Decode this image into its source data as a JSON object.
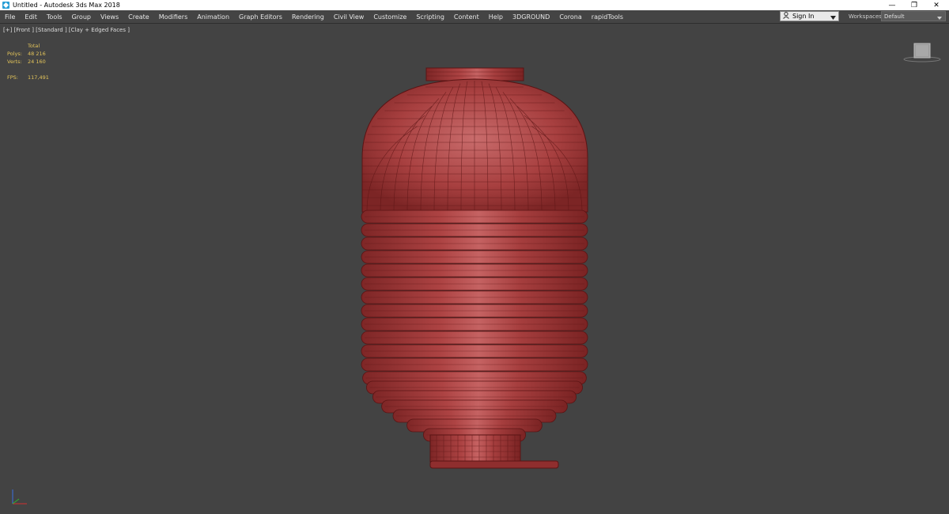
{
  "window": {
    "title": "Untitled - Autodesk 3ds Max 2018",
    "minimize_glyph": "—",
    "restore_glyph": "❐",
    "close_glyph": "✕"
  },
  "menu": [
    "File",
    "Edit",
    "Tools",
    "Group",
    "Views",
    "Create",
    "Modifiers",
    "Animation",
    "Graph Editors",
    "Rendering",
    "Civil View",
    "Customize",
    "Scripting",
    "Content",
    "Help",
    "3DGROUND",
    "Corona",
    "rapidTools"
  ],
  "account": {
    "sign_in": "Sign In"
  },
  "workspaces": {
    "label": "Workspaces:",
    "value": "Default"
  },
  "viewport": {
    "label": "[+] [Front ] [Standard ] [Clay + Edged Faces ]",
    "stats": {
      "header": "Total",
      "polys_label": "Polys:",
      "polys_value": "48 216",
      "verts_label": "Verts:",
      "verts_value": "24 160",
      "fps_label": "FPS:",
      "fps_value": "117,491"
    }
  },
  "colors": {
    "model_fill": "#9e3434",
    "model_light": "#c45a5a",
    "wire": "#5a1414",
    "stats_text": "#e3c45a"
  }
}
